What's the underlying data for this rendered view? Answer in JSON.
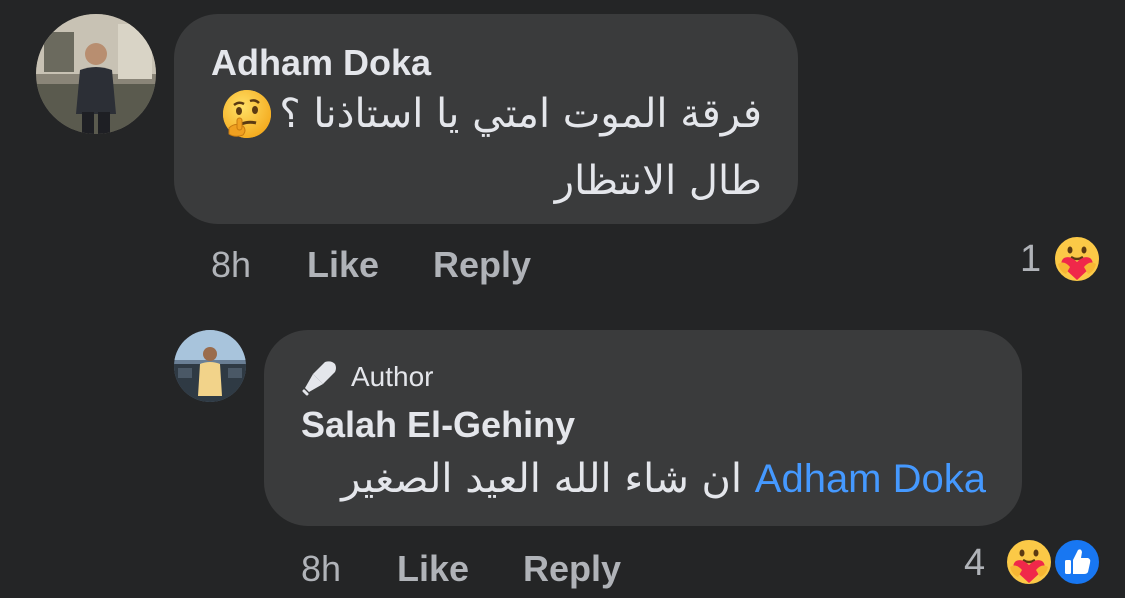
{
  "comment": {
    "author": "Adham Doka",
    "line1": "فرقة الموت امتي يا استاذنا ؟",
    "line2": "طال الانتظار",
    "emoji_icon": "thinking-face-icon",
    "time": "8h",
    "like_label": "Like",
    "reply_label": "Reply",
    "reaction_count": "1",
    "reaction_icon": "care-reaction-icon"
  },
  "reply": {
    "badge": "Author",
    "badge_icon": "microphone-icon",
    "author": "Salah El-Gehiny",
    "text": "ان شاء الله العيد الصغير",
    "mention": "Adham Doka",
    "time": "8h",
    "like_label": "Like",
    "reply_label": "Reply",
    "reaction_count": "4",
    "reaction_icons": [
      "care-reaction-icon",
      "like-reaction-icon"
    ]
  },
  "colors": {
    "background": "#242526",
    "bubble": "#3a3b3c",
    "mention": "#4599ff",
    "like_blue": "#1877f2"
  }
}
